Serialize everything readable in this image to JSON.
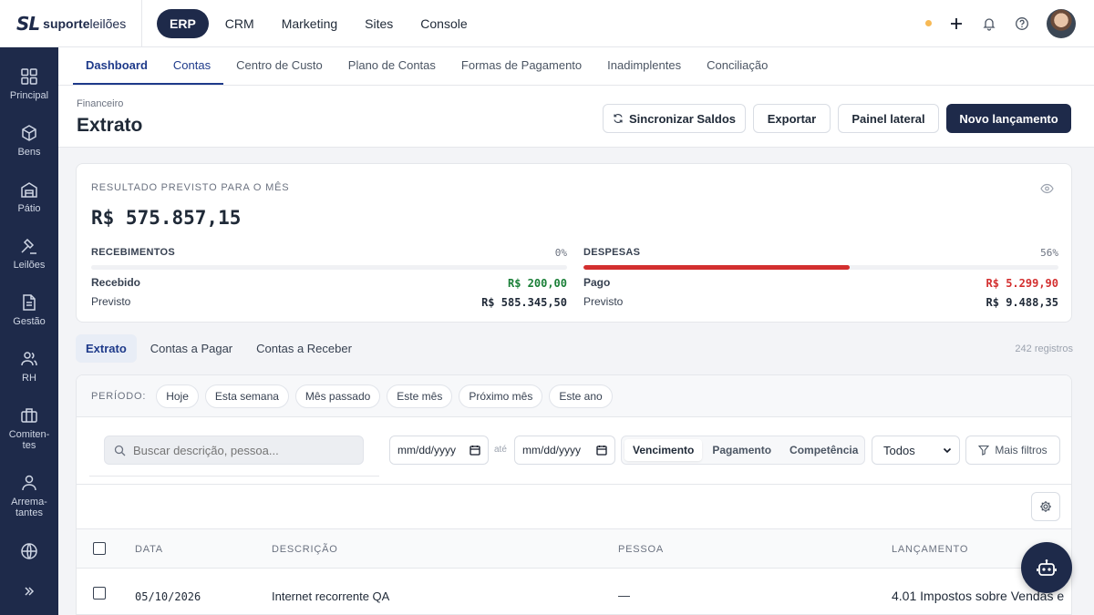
{
  "app": {
    "logo_mark": "SL",
    "logo_text_bold": "suporte",
    "logo_text": "leilões",
    "nav": [
      {
        "label": "ERP",
        "active": true
      },
      {
        "label": "CRM"
      },
      {
        "label": "Marketing"
      },
      {
        "label": "Sites"
      },
      {
        "label": "Console"
      }
    ]
  },
  "sidebar": {
    "items": [
      {
        "label": "Principal",
        "icon": "grid-icon"
      },
      {
        "label": "Bens",
        "icon": "box-icon"
      },
      {
        "label": "Pátio",
        "icon": "warehouse-icon"
      },
      {
        "label": "Leilões",
        "icon": "gavel-icon"
      },
      {
        "label": "Gestão",
        "icon": "document-icon"
      },
      {
        "label": "RH",
        "icon": "users-icon"
      },
      {
        "label": "Comiten-\ntes",
        "icon": "briefcase-icon"
      },
      {
        "label": "Arrema-\ntantes",
        "icon": "user-icon"
      },
      {
        "label": "",
        "icon": "globe-icon"
      }
    ]
  },
  "subnav": {
    "tabs": [
      "Dashboard",
      "Contas",
      "Centro de Custo",
      "Plano de Contas",
      "Formas de Pagamento",
      "Inadimplentes",
      "Conciliação"
    ]
  },
  "header": {
    "breadcrumb": "Financeiro",
    "title": "Extrato",
    "sync_label": "Sincronizar Saldos",
    "export_label": "Exportar",
    "panel_label": "Painel lateral",
    "new_label": "Novo lançamento"
  },
  "summary": {
    "label": "RESULTADO PREVISTO PARA O MÊS",
    "total": "R$ 575.857,15",
    "receipts": {
      "title": "RECEBIMENTOS",
      "percent": "0%",
      "progress": 0,
      "received_label": "Recebido",
      "received_value": "R$ 200,00",
      "expected_label": "Previsto",
      "expected_value": "R$ 585.345,50"
    },
    "expenses": {
      "title": "DESPESAS",
      "percent": "56%",
      "progress": 0.56,
      "paid_label": "Pago",
      "paid_value": "R$ 5.299,90",
      "expected_label": "Previsto",
      "expected_value": "R$ 9.488,35"
    },
    "colors": {
      "positive": "#1a7f37",
      "negative": "#d32f2f"
    }
  },
  "list_tabs": [
    "Extrato",
    "Contas a Pagar",
    "Contas a Receber"
  ],
  "records_count": "242 registros",
  "filters": {
    "period_label": "PERÍODO:",
    "period_chips": [
      "Hoje",
      "Esta semana",
      "Mês passado",
      "Este mês",
      "Próximo mês",
      "Este ano"
    ],
    "search_placeholder": "Buscar descrição, pessoa...",
    "date_from": "mm/dd/yyyy",
    "date_to": "mm/dd/yyyy",
    "date_separator": "até",
    "date_modes": [
      "Vencimento",
      "Pagamento",
      "Competência"
    ],
    "status_value": "Todos",
    "more_filters": "Mais filtros"
  },
  "table": {
    "columns": [
      "DATA",
      "DESCRIÇÃO",
      "PESSOA",
      "LANÇAMENTO"
    ],
    "rows": [
      {
        "date": "05/10/2026",
        "description": "Internet recorrente QA",
        "person": "—",
        "entry": "4.01 Impostos sobre Vendas e"
      }
    ]
  }
}
